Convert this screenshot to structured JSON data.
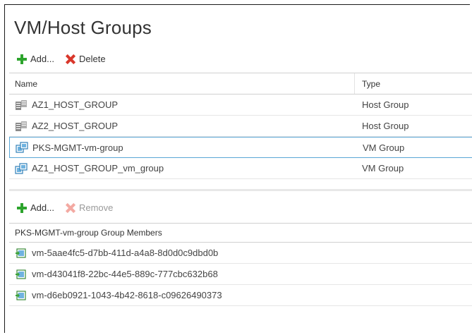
{
  "title": "VM/Host Groups",
  "groups_toolbar": {
    "add_label": "Add...",
    "delete_label": "Delete"
  },
  "groups_table": {
    "columns": [
      "Name",
      "Type"
    ],
    "rows": [
      {
        "name": "AZ1_HOST_GROUP",
        "type": "Host Group",
        "icon": "host-group-icon"
      },
      {
        "name": "AZ2_HOST_GROUP",
        "type": "Host Group",
        "icon": "host-group-icon"
      },
      {
        "name": "PKS-MGMT-vm-group",
        "type": "VM Group",
        "icon": "vm-group-icon",
        "selected": true
      },
      {
        "name": "AZ1_HOST_GROUP_vm_group",
        "type": "VM Group",
        "icon": "vm-group-icon"
      }
    ]
  },
  "members_toolbar": {
    "add_label": "Add...",
    "remove_label": "Remove"
  },
  "members_table": {
    "header": "PKS-MGMT-vm-group Group Members",
    "rows": [
      {
        "name": "vm-5aae4fc5-d7bb-411d-a4a8-8d0d0c9dbd0b",
        "icon": "vm-icon"
      },
      {
        "name": "vm-d43041f8-22bc-44e5-889c-777cbc632b68",
        "icon": "vm-icon"
      },
      {
        "name": "vm-d6eb0921-1043-4b42-8618-c09626490373",
        "icon": "vm-icon"
      }
    ]
  },
  "colors": {
    "add_green": "#2da42d",
    "delete_red": "#d9372b",
    "selection_border": "#5aa7d6"
  }
}
